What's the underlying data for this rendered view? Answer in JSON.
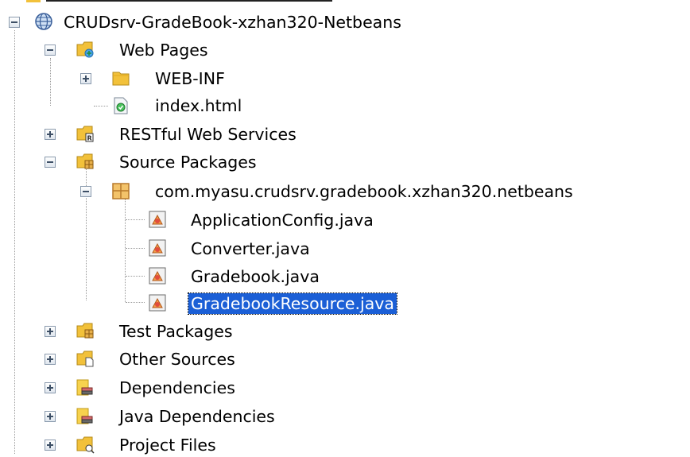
{
  "tree": {
    "project": {
      "label": "CRUDsrv-GradeBook-xzhan320-Netbeans",
      "icon": "globe-project-icon",
      "expanded": true
    },
    "web_pages": {
      "label": "Web Pages",
      "icon": "web-pages-folder-icon",
      "expanded": true,
      "children": [
        {
          "label": "WEB-INF",
          "icon": "folder-icon",
          "expanded": false
        },
        {
          "label": "index.html",
          "icon": "html-file-icon"
        }
      ]
    },
    "restful": {
      "label": "RESTful Web Services",
      "icon": "rest-services-folder-icon",
      "expanded": false
    },
    "source_packages": {
      "label": "Source Packages",
      "icon": "source-packages-folder-icon",
      "expanded": true,
      "package": {
        "label": "com.myasu.crudsrv.gradebook.xzhan320.netbeans",
        "icon": "package-icon",
        "expanded": true,
        "files": [
          {
            "label": "ApplicationConfig.java",
            "icon": "java-class-icon",
            "selected": false
          },
          {
            "label": "Converter.java",
            "icon": "java-class-icon",
            "selected": false
          },
          {
            "label": "Gradebook.java",
            "icon": "java-class-icon",
            "selected": false
          },
          {
            "label": "GradebookResource.java",
            "icon": "java-class-icon",
            "selected": true
          }
        ]
      }
    },
    "test_packages": {
      "label": "Test Packages",
      "icon": "test-packages-folder-icon",
      "expanded": false
    },
    "other_sources": {
      "label": "Other Sources",
      "icon": "other-sources-folder-icon",
      "expanded": false
    },
    "dependencies": {
      "label": "Dependencies",
      "icon": "library-icon",
      "expanded": false
    },
    "java_dependencies": {
      "label": "Java Dependencies",
      "icon": "library-icon",
      "expanded": false
    },
    "project_files": {
      "label": "Project Files",
      "icon": "project-files-folder-icon",
      "expanded": false
    }
  },
  "colors": {
    "selection": "#1b5fd6",
    "folder": "#f2c13a"
  }
}
